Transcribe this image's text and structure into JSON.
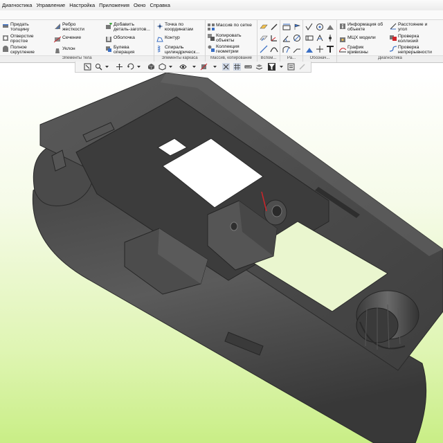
{
  "menu": [
    "Диагностика",
    "Управление",
    "Настройка",
    "Приложения",
    "Окно",
    "Справка"
  ],
  "ribbon": {
    "groups": [
      {
        "caption": "Элементы тела",
        "commands": [
          {
            "label": "Придать\nтолщину",
            "icon": "thicken-icon"
          },
          {
            "label": "Отверстие\nпростое",
            "icon": "hole-icon"
          },
          {
            "label": "Полное\nскругление",
            "icon": "full-fillet-icon"
          },
          {
            "label": "Ребро\nжесткости",
            "icon": "rib-icon"
          },
          {
            "label": "Сечение",
            "icon": "section-icon"
          },
          {
            "label": "Уклон",
            "icon": "draft-icon"
          },
          {
            "label": "Добавить\nдеталь-заготов...",
            "icon": "add-blank-icon"
          },
          {
            "label": "Оболочка",
            "icon": "shell-icon"
          },
          {
            "label": "Булева\nоперация",
            "icon": "boolean-icon"
          }
        ]
      },
      {
        "caption": "Элементы каркаса",
        "commands": [
          {
            "label": "Точка по\nкоординатам",
            "icon": "point-icon"
          },
          {
            "label": "Контур",
            "icon": "contour-icon"
          },
          {
            "label": "Спираль\nцилиндрическ...",
            "icon": "helix-icon"
          }
        ]
      },
      {
        "caption": "Массив, копирование",
        "commands": [
          {
            "label": "Массив по сетке",
            "icon": "grid-array-icon"
          },
          {
            "label": "Копировать\nобъекты",
            "icon": "copy-objects-icon"
          },
          {
            "label": "Коллекция\nгеометрии",
            "icon": "geometry-collection-icon"
          }
        ]
      },
      {
        "caption": "Вспом...",
        "commands": []
      },
      {
        "caption": "Ра...",
        "commands": []
      },
      {
        "caption": "Обознач...",
        "commands": []
      },
      {
        "caption": "Диагностика",
        "commands": [
          {
            "label": "Информация об\nобъекте",
            "icon": "object-info-icon"
          },
          {
            "label": "МЦХ модели",
            "icon": "mass-properties-icon"
          },
          {
            "label": "График\nкривизны",
            "icon": "curvature-graph-icon"
          },
          {
            "label": "Расстояние и\nугол",
            "icon": "distance-angle-icon"
          },
          {
            "label": "Проверка\nколлизий",
            "icon": "collision-check-icon"
          },
          {
            "label": "Проверка\nнепрерывности",
            "icon": "continuity-check-icon"
          }
        ]
      }
    ]
  },
  "colors": {
    "viewport_top": "#ffffff",
    "viewport_bottom": "#c9ee86",
    "model": "#4a4a4a",
    "accent_red": "#d0242a"
  }
}
